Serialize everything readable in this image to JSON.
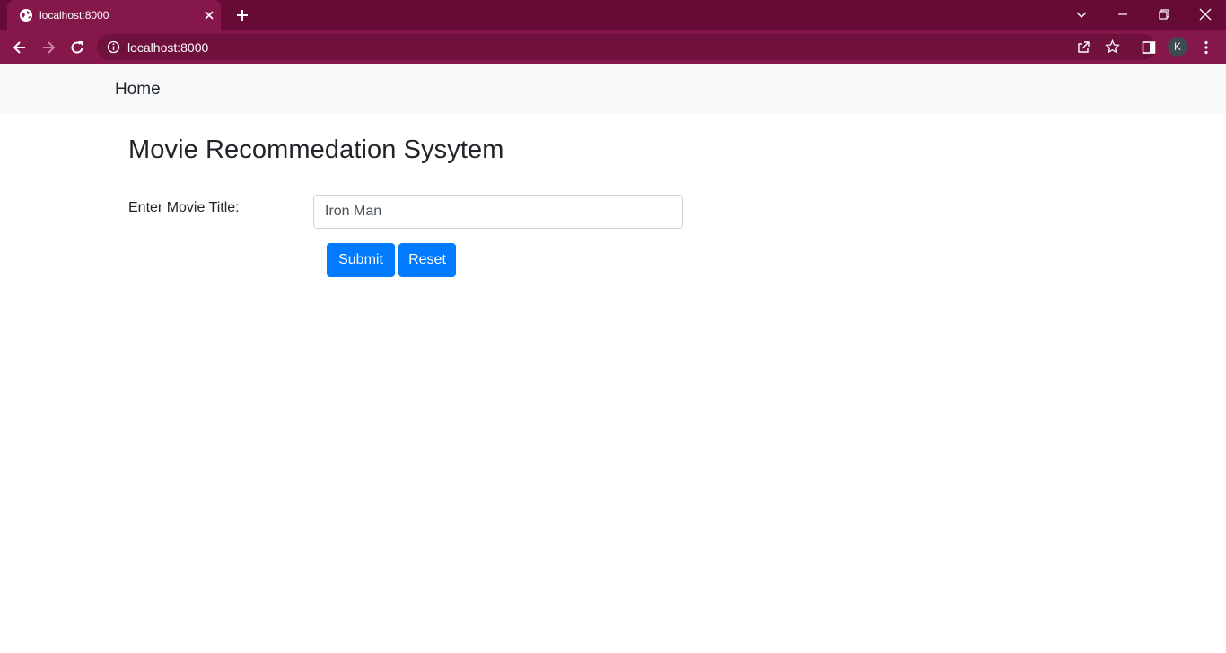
{
  "browser": {
    "tab_title": "localhost:8000",
    "url": "localhost:8000",
    "profile_initial": "K",
    "colors": {
      "titlebar": "#660b35",
      "toolbar": "#85174a",
      "omnibox": "#70103d"
    }
  },
  "navbar": {
    "brand": "Home"
  },
  "page": {
    "title": "Movie Recommedation Sysytem",
    "form": {
      "label": "Enter Movie Title:",
      "input_value": "Iron Man",
      "submit_label": "Submit",
      "reset_label": "Reset"
    },
    "colors": {
      "primary_button": "#007bff",
      "navbar_bg": "#f8f9fa"
    }
  }
}
